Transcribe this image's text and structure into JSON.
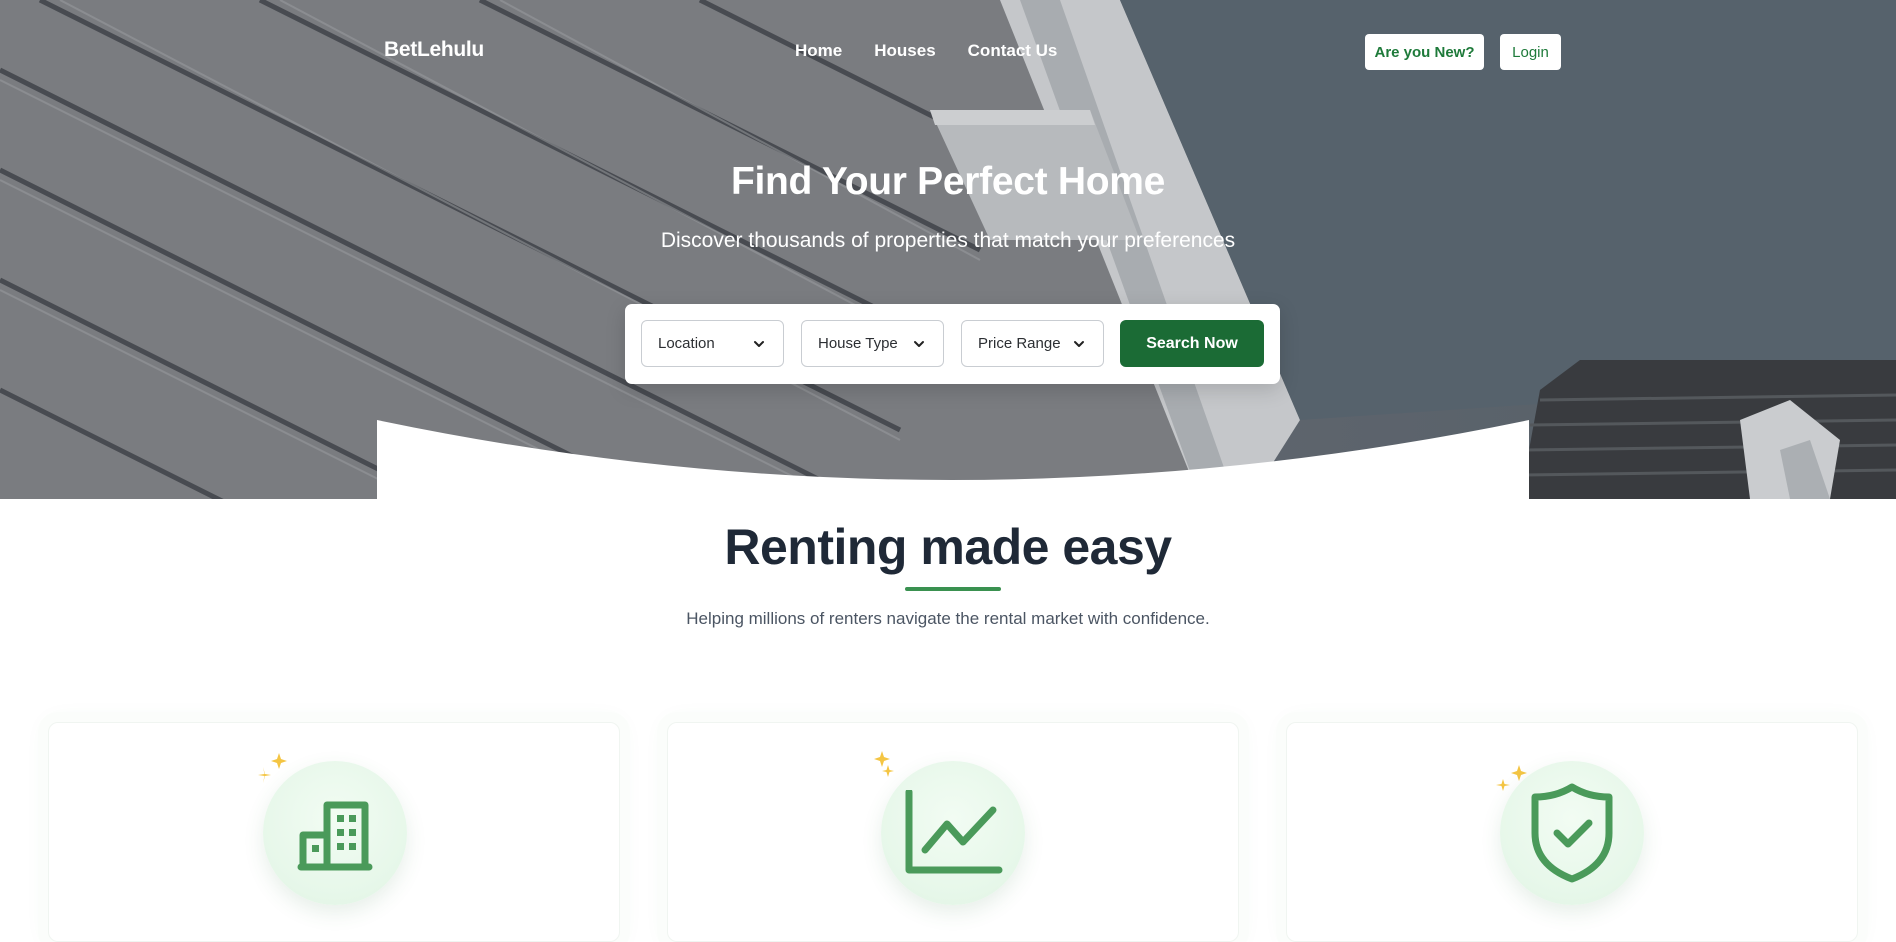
{
  "brand": "BetLehulu",
  "nav": {
    "home": "Home",
    "houses": "Houses",
    "contact": "Contact Us"
  },
  "auth": {
    "new_label": "Are you New?",
    "login_label": "Login"
  },
  "hero": {
    "title": "Find Your Perfect Home",
    "subtitle": "Discover thousands of properties that match your preferences"
  },
  "search": {
    "location": "Location",
    "house_type": "House Type",
    "price_range": "Price Range",
    "button": "Search Now"
  },
  "section": {
    "title": "Renting made easy",
    "subtitle": "Helping millions of renters navigate the rental market with confidence."
  },
  "features": [
    {
      "icon": "building-icon"
    },
    {
      "icon": "chart-line-icon"
    },
    {
      "icon": "shield-check-icon"
    }
  ],
  "colors": {
    "accent": "#1b6b35",
    "icon_green": "#4a9a5a",
    "sparkle": "#f4c543",
    "heading": "#1f2937"
  }
}
